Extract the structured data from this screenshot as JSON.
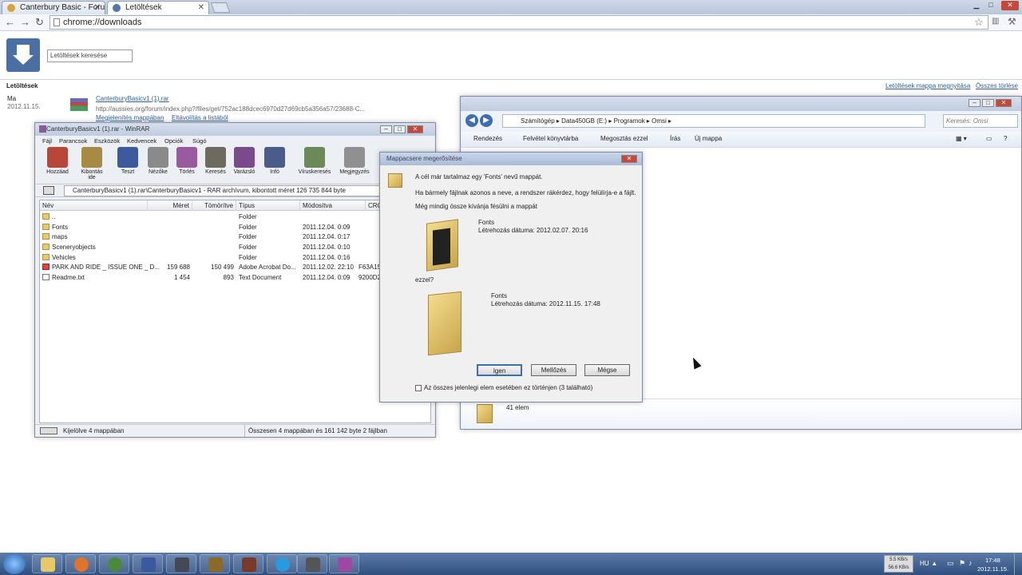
{
  "browser": {
    "tabs": [
      {
        "label": "Canterbury Basic - Forum",
        "favicon_color": "#d9a23a"
      },
      {
        "label": "Letöltések",
        "favicon_color": "#5576a8"
      }
    ],
    "address": "chrome://downloads"
  },
  "downloads": {
    "search_placeholder": "Letöltések keresése",
    "header": "Letöltések",
    "open_folder_link": "Letöltések mappa megnyitása",
    "clear_all_link": "Összes törlése",
    "date_label": "Ma",
    "date_value": "2012.11.15.",
    "item": {
      "name": "CanterburyBasicv1 (1).rar",
      "url": "http://aussies.org/forum/index.php?/files/get/752ac188dcec6970d27d69cb5a356a57/23688-C...",
      "show_in_folder": "Megjelenítés mappában",
      "remove": "Eltávolítás a listából"
    }
  },
  "winrar": {
    "title": "CanterburyBasicv1 (1).rar - WinRAR",
    "menu": [
      "Fájl",
      "Parancsok",
      "Eszközök",
      "Kedvencek",
      "Opciók",
      "Súgó"
    ],
    "tools": [
      {
        "label": "Hozzáad",
        "color": "#b8473a"
      },
      {
        "label": "Kibontás ide",
        "color": "#a98a45"
      },
      {
        "label": "Teszt",
        "color": "#3d5a9a"
      },
      {
        "label": "Nézőke",
        "color": "#8a8a8a"
      },
      {
        "label": "Törlés",
        "color": "#9a5aa0"
      },
      {
        "label": "Keresés",
        "color": "#6d6a60"
      },
      {
        "label": "Varázsló",
        "color": "#7a4a8c"
      },
      {
        "label": "Infó",
        "color": "#4b5c8a"
      },
      {
        "label": "Víruskeresés",
        "color": "#6b8a58"
      },
      {
        "label": "Megjegyzés",
        "color": "#909090"
      }
    ],
    "path": "CanterburyBasicv1 (1).rar\\CanterburyBasicv1 - RAR archívum, kibontott méret 126 735 844 byte",
    "columns": [
      "Név",
      "Méret",
      "Tömörítve",
      "Típus",
      "Módosítva",
      "CRC"
    ],
    "rows": [
      {
        "name": "..",
        "size": "",
        "packed": "",
        "type": "Folder",
        "modified": "",
        "crc": ""
      },
      {
        "name": "Fonts",
        "size": "",
        "packed": "",
        "type": "Folder",
        "modified": "2011.12.04. 0:09",
        "crc": ""
      },
      {
        "name": "maps",
        "size": "",
        "packed": "",
        "type": "Folder",
        "modified": "2011.12.04. 0:17",
        "crc": ""
      },
      {
        "name": "Sceneryobjects",
        "size": "",
        "packed": "",
        "type": "Folder",
        "modified": "2011.12.04. 0:10",
        "crc": ""
      },
      {
        "name": "Vehicles",
        "size": "",
        "packed": "",
        "type": "Folder",
        "modified": "2011.12.04. 0:16",
        "crc": ""
      },
      {
        "name": "PARK AND RIDE _ ISSUE ONE _ D...",
        "size": "159 688",
        "packed": "150 499",
        "type": "Adobe Acrobat Do...",
        "modified": "2011.12.02. 22:10",
        "crc": "F63A15..."
      },
      {
        "name": "Readme.txt",
        "size": "1 454",
        "packed": "893",
        "type": "Text Document",
        "modified": "2011.12.04. 0:09",
        "crc": "9200D2..."
      }
    ],
    "status_left": "Kijelölve 4 mappában",
    "status_right": "Összesen 4 mappában és 161 142 byte 2 fájlban"
  },
  "explorer": {
    "breadcrumb": [
      "Számítógép",
      "Data450GB (E:)",
      "Programok",
      "Omsi"
    ],
    "search_placeholder": "Keresés: Omsi",
    "commands": [
      "Rendezés",
      "Felvétel könyvtárba",
      "Megosztás ezzel",
      "Írás",
      "Új mappa"
    ],
    "count": "41 elem"
  },
  "dialog": {
    "title": "Mappacsere megerősítése",
    "line1": "A cél már tartalmaz egy 'Fonts' nevű mappát.",
    "line2": "Ha bármely fájlnak azonos a neve, a rendszer rákérdez, hogy felülírja-e a fájlt.",
    "line3": "Még mindig össze kívánja fésülni a mappát",
    "target": {
      "name": "Fonts",
      "created": "Létrehozás dátuma: 2012.02.07. 20:16"
    },
    "with_label": "ezzel?",
    "source": {
      "name": "Fonts",
      "created": "Létrehozás dátuma: 2012.11.15. 17:48"
    },
    "buttons": [
      "Igen",
      "Mellőzés",
      "Mégse"
    ],
    "checkbox": "Az összes jelenlegi elem esetében ez történjen (3 található)"
  },
  "taskbar": {
    "apps": [
      {
        "name": "explorer",
        "color": "#e8c96a"
      },
      {
        "name": "firefox",
        "color": "#e0742a"
      },
      {
        "name": "chrome",
        "color": "#4a8a3a"
      },
      {
        "name": "notepad",
        "color": "#3a5aa0"
      },
      {
        "name": "steam",
        "color": "#444a55"
      },
      {
        "name": "winamp",
        "color": "#8a6a2a"
      },
      {
        "name": "app",
        "color": "#7a3a2a"
      },
      {
        "name": "skype",
        "color": "#2a9ae0"
      },
      {
        "name": "game",
        "color": "#555"
      },
      {
        "name": "winrar",
        "color": "#9a4aa0"
      }
    ],
    "lang": "HU",
    "time": "17:48",
    "date": "2012.11.15.",
    "net_up": "5.5 KB/s",
    "net_down": "56.6 KB/s"
  }
}
